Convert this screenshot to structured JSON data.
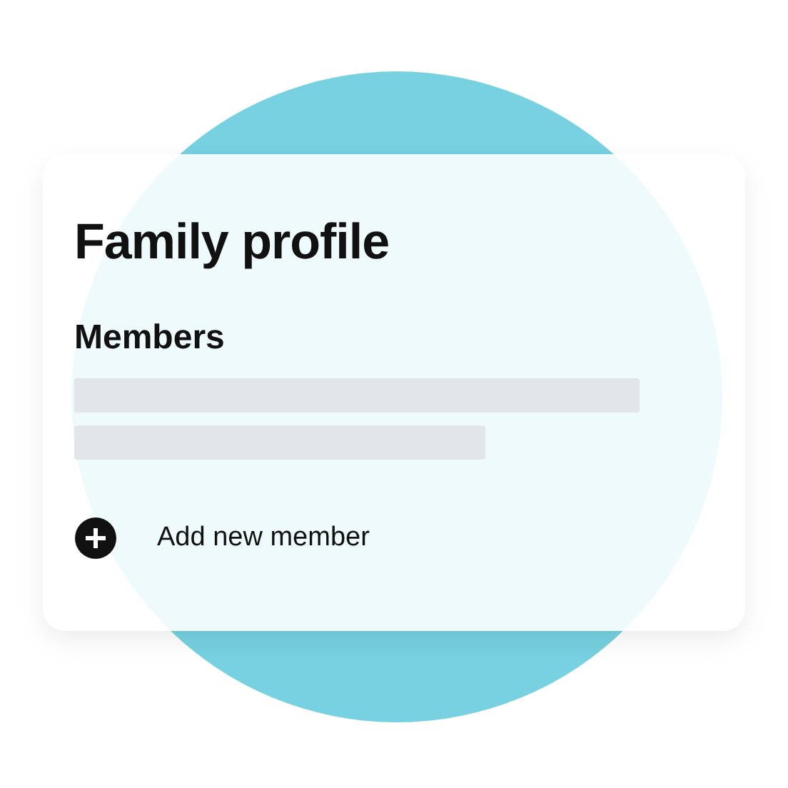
{
  "card": {
    "title": "Family profile",
    "section": "Members",
    "action": {
      "label": "Add new member"
    }
  }
}
